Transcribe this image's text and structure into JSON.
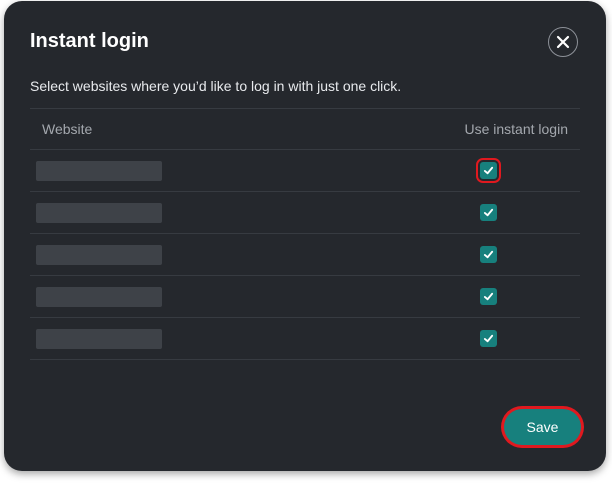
{
  "dialog": {
    "title": "Instant login",
    "subtitle": "Select websites where you’d like to log in with just one click.",
    "close_icon": "close-icon"
  },
  "table": {
    "headers": {
      "website": "Website",
      "instant_login": "Use instant login"
    },
    "rows": [
      {
        "website": "",
        "instant_login": true,
        "highlighted": true
      },
      {
        "website": "",
        "instant_login": true,
        "highlighted": false
      },
      {
        "website": "",
        "instant_login": true,
        "highlighted": false
      },
      {
        "website": "",
        "instant_login": true,
        "highlighted": false
      },
      {
        "website": "",
        "instant_login": true,
        "highlighted": false
      }
    ]
  },
  "footer": {
    "save_label": "Save"
  },
  "colors": {
    "background": "#25282d",
    "accent": "#17807d",
    "highlight": "#e0191f"
  }
}
